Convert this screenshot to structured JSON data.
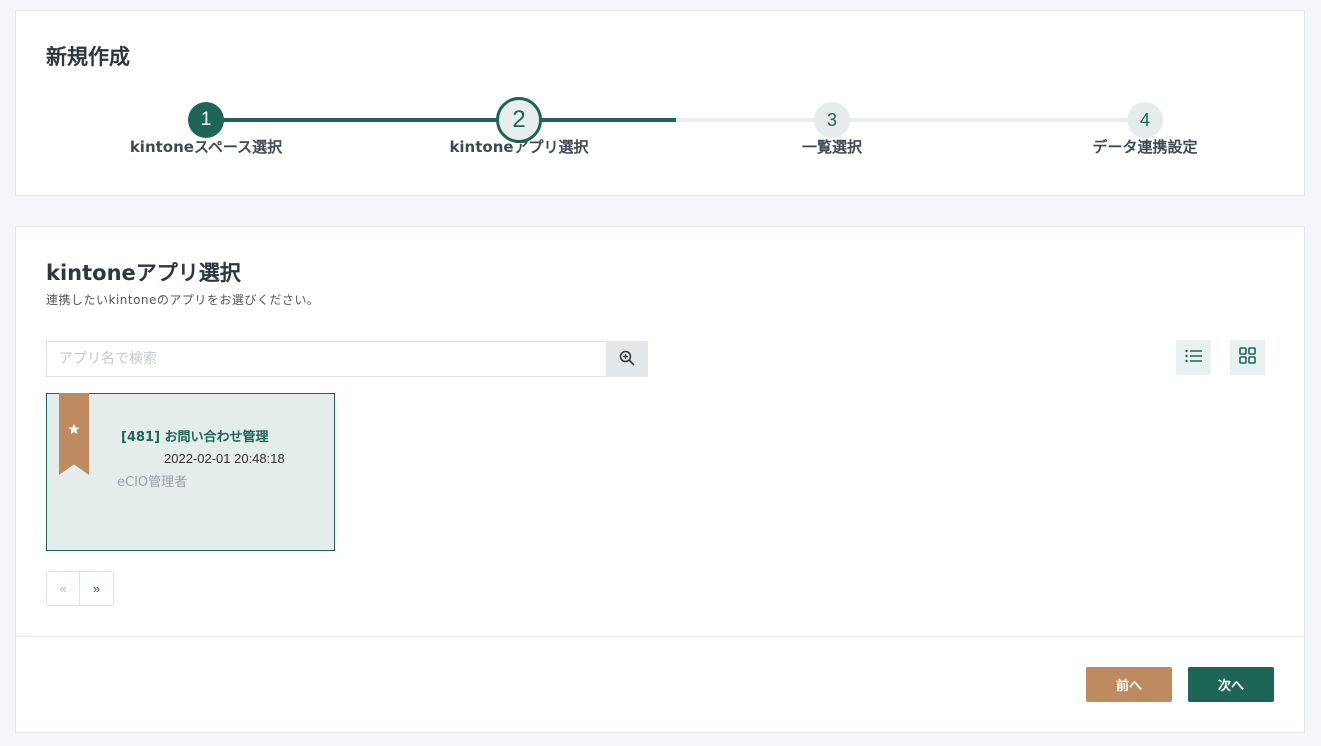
{
  "header": {
    "title": "新規作成"
  },
  "stepper": {
    "steps": [
      {
        "number": "1",
        "label": "kintoneスペース選択",
        "state": "done"
      },
      {
        "number": "2",
        "label": "kintoneアプリ選択",
        "state": "active"
      },
      {
        "number": "3",
        "label": "一覧選択",
        "state": "todo"
      },
      {
        "number": "4",
        "label": "データ連携設定",
        "state": "todo"
      }
    ]
  },
  "main": {
    "title": "kintoneアプリ選択",
    "description": "連携したいkintoneのアプリをお選びください。",
    "search": {
      "placeholder": "アプリ名で検索",
      "value": "",
      "icon": "zoom-in-icon"
    },
    "view_toggle": {
      "list_icon": "list-icon",
      "grid_icon": "grid-icon"
    },
    "apps": [
      {
        "title": "[481] お問い合わせ管理",
        "date": "2022-02-01 20:48:18",
        "owner": "eCIO管理者",
        "favorite": true,
        "icon": "star-bookmark-icon"
      }
    ],
    "pagination": {
      "prev_label": "«",
      "next_label": "»"
    }
  },
  "footer": {
    "prev_label": "前へ",
    "next_label": "次へ"
  },
  "colors": {
    "primary": "#1d6656",
    "accent": "#bd8b5f",
    "card_bg": "#e4edec",
    "page_bg": "#f4f6f9"
  }
}
